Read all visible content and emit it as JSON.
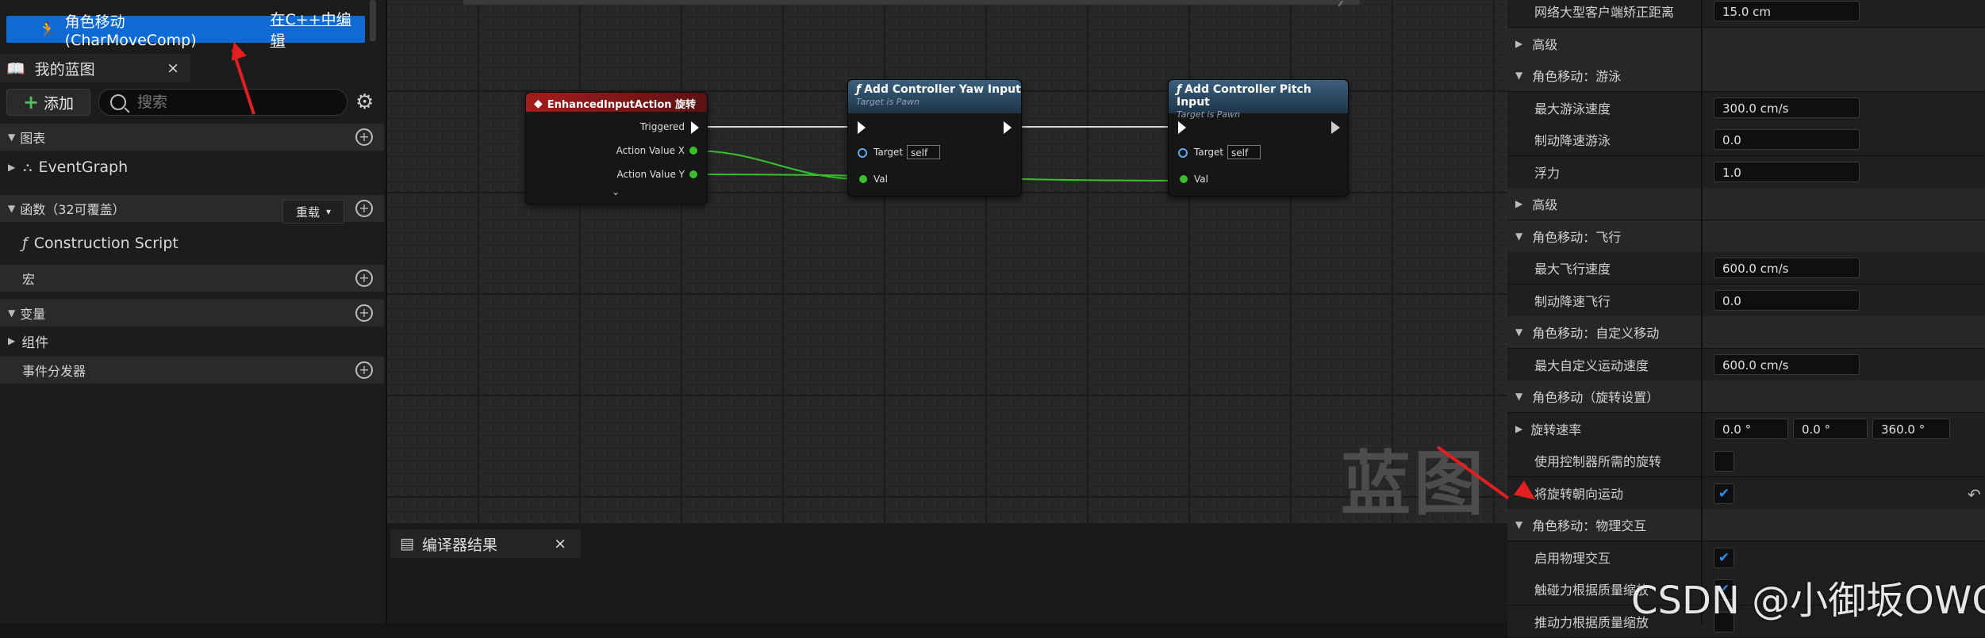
{
  "left_panel": {
    "component_row": {
      "name": "角色移动 (CharMoveComp)",
      "edit_link": "在C++中编辑"
    },
    "tab": {
      "label": "我的蓝图",
      "close": "×"
    },
    "add_button": "添加",
    "search_placeholder": "搜索",
    "sections": {
      "graphs": "图表",
      "event_graph": "EventGraph",
      "functions": "函数（32可覆盖）",
      "override": "重载",
      "construction": "Construction Script",
      "macros": "宏",
      "variables": "变量",
      "components": "组件",
      "dispatchers": "事件分发器"
    }
  },
  "graph": {
    "watermark": "蓝图",
    "nodes": {
      "input_action": {
        "title": "EnhancedInputAction 旋转",
        "pins": [
          "Triggered",
          "Action Value X",
          "Action Value Y"
        ]
      },
      "yaw": {
        "title": "Add Controller Yaw Input",
        "subtitle": "Target is Pawn",
        "target": "Target",
        "self": "self",
        "val": "Val"
      },
      "pitch": {
        "title": "Add Controller Pitch Input",
        "subtitle": "Target is Pawn",
        "target": "Target",
        "self": "self",
        "val": "Val"
      }
    }
  },
  "compiler_tab": {
    "label": "编译器结果",
    "close": "×"
  },
  "details": {
    "rows": [
      {
        "type": "prop",
        "label": "网络大型客户端矫正距离",
        "value": "15.0 cm"
      },
      {
        "type": "sub",
        "label": "高级"
      },
      {
        "type": "cat",
        "label": "角色移动：游泳"
      },
      {
        "type": "prop",
        "label": "最大游泳速度",
        "value": "300.0 cm/s"
      },
      {
        "type": "prop",
        "label": "制动降速游泳",
        "value": "0.0"
      },
      {
        "type": "prop",
        "label": "浮力",
        "value": "1.0"
      },
      {
        "type": "sub",
        "label": "高级"
      },
      {
        "type": "cat",
        "label": "角色移动：飞行"
      },
      {
        "type": "prop",
        "label": "最大飞行速度",
        "value": "600.0 cm/s"
      },
      {
        "type": "prop",
        "label": "制动降速飞行",
        "value": "0.0"
      },
      {
        "type": "cat",
        "label": "角色移动：自定义移动"
      },
      {
        "type": "prop",
        "label": "最大自定义运动速度",
        "value": "600.0 cm/s"
      },
      {
        "type": "cat",
        "label": "角色移动（旋转设置）"
      },
      {
        "type": "rot",
        "label": "旋转速率",
        "values": [
          "0.0 °",
          "0.0 °",
          "360.0 °"
        ]
      },
      {
        "type": "check",
        "label": "使用控制器所需的旋转",
        "checked": false
      },
      {
        "type": "check",
        "label": "将旋转朝向运动",
        "checked": true
      },
      {
        "type": "cat",
        "label": "角色移动：物理交互"
      },
      {
        "type": "check",
        "label": "启用物理交互",
        "checked": true
      },
      {
        "type": "check",
        "label": "触碰力根据质量缩放",
        "checked": true
      },
      {
        "type": "check",
        "label": "推动力根据质量缩放",
        "checked": false
      }
    ]
  },
  "watermark_csdn": "CSDN @小御坂OWO",
  "colors": {
    "selection": "#0f6ad4",
    "event_node": "#9b1a1a",
    "function_node": "#2c4b63",
    "wire_green": "#39c12c",
    "annotation_arrow": "#e02020"
  }
}
